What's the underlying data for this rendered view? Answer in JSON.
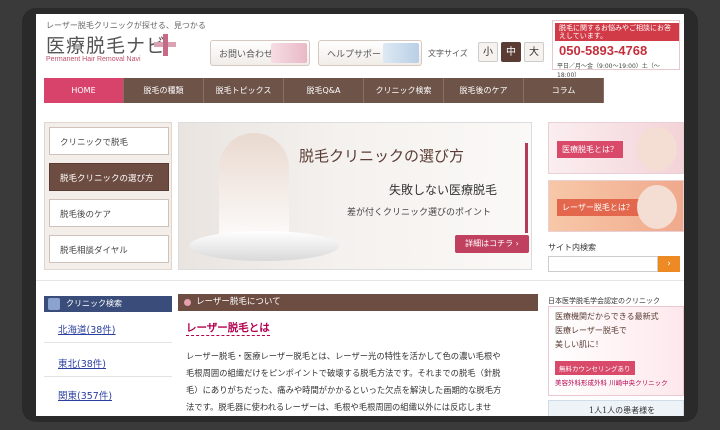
{
  "header": {
    "tagline": "レーザー脱毛クリニックが探せる、見つかる",
    "logo": "医療脱毛ナビ",
    "logo_sub": "Permanent Hair Removal Navi",
    "contact_label": "お問い合わせ",
    "help_label": "ヘルプサポート",
    "font_size_label": "文字サイズ",
    "font_sizes": [
      "小",
      "中",
      "大"
    ],
    "phone_note": "脱毛に関するお悩みやご相談にお答えしています。",
    "phone_number": "050-5893-4768",
    "phone_hours": "平日／月～金（9:00～19:00）土（～18:00）"
  },
  "nav": {
    "items": [
      "HOME",
      "脱毛の種類",
      "脱毛トピックス",
      "脱毛Q&A",
      "クリニック検索",
      "脱毛後のケア",
      "コラム"
    ]
  },
  "sidemenu": {
    "items": [
      "クリニックで脱毛",
      "脱毛クリニックの選び方",
      "脱毛後のケア",
      "脱毛相談ダイヤル"
    ]
  },
  "hero": {
    "title": "脱毛クリニックの選び方",
    "sub1": "失敗しない医療脱毛",
    "sub2": "差が付くクリニック選びのポイント",
    "more_label": "詳細はコチラ ›"
  },
  "right": {
    "banner1": "医療脱毛とは？",
    "banner2": "レーザー脱毛とは？",
    "search_label": "サイト内検索",
    "search_btn": "›"
  },
  "clinic_search": {
    "title": "クリニック検索",
    "regions": [
      "北海道(38件)",
      "東北(38件)",
      "関東(357件)"
    ]
  },
  "article": {
    "section_title": "レーザー脱毛について",
    "title": "レーザー脱毛とは",
    "lines": [
      "レーザー脱毛・医療レーザー脱毛とは、レーザー光の特性を活かして色の濃い毛根や",
      "毛根周囲の組織だけをピンポイントで破壊する脱毛方法です。それまでの脱毛（針脱",
      "毛）にありがちだった、痛みや時間がかかるといった欠点を解決した画期的な脱毛方",
      "法です。脱毛器に使われるレーザーは、毛根や毛根周囲の組織以外には反応しませ"
    ]
  },
  "ads": {
    "cert_title": "日本医学脱毛学会認定のクリニック",
    "cert_l1": "医療機関だからできる最新式",
    "cert_l2": "医療レーザー脱毛で",
    "cert_l3": "美しい肌に！",
    "cert_badge": "無料カウンセリングあり",
    "cert_foot": "美容外科形成外科 川崎中央クリニック",
    "patient_text": "1人1人の患者様を"
  }
}
